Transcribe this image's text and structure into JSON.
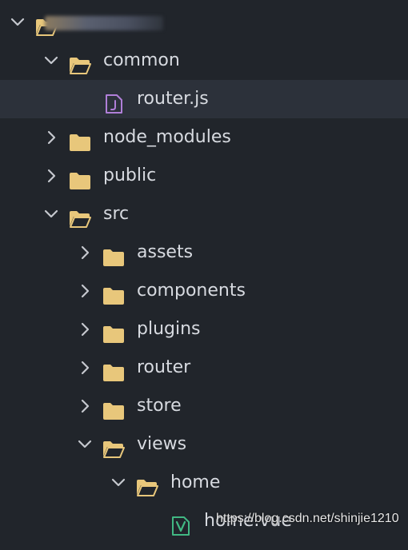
{
  "explorer": {
    "root": {
      "label": "",
      "expanded": true
    },
    "items": [
      {
        "label": "common",
        "type": "folder",
        "expanded": true
      },
      {
        "label": "router.js",
        "type": "file-js",
        "selected": true
      },
      {
        "label": "node_modules",
        "type": "folder",
        "expanded": false
      },
      {
        "label": "public",
        "type": "folder",
        "expanded": false
      },
      {
        "label": "src",
        "type": "folder",
        "expanded": true
      },
      {
        "label": "assets",
        "type": "folder",
        "expanded": false
      },
      {
        "label": "components",
        "type": "folder",
        "expanded": false
      },
      {
        "label": "plugins",
        "type": "folder",
        "expanded": false
      },
      {
        "label": "router",
        "type": "folder",
        "expanded": false
      },
      {
        "label": "store",
        "type": "folder",
        "expanded": false
      },
      {
        "label": "views",
        "type": "folder",
        "expanded": true
      },
      {
        "label": "home",
        "type": "folder",
        "expanded": true
      },
      {
        "label": "home.vue",
        "type": "file-vue"
      }
    ]
  },
  "watermark": "https://blog.csdn.net/shinjie1210",
  "colors": {
    "background": "#21252b",
    "selected_row": "#2c313a",
    "text": "#d7dae0",
    "chevron": "#c5c8ce",
    "folder": "#e8c77b",
    "js_icon": "#b07fd8",
    "vue_icon": "#41b883"
  },
  "icons": {
    "collapsed": "chevron-right-icon",
    "expanded": "chevron-down-icon",
    "folder_closed": "folder-icon",
    "folder_open": "folder-open-icon",
    "js_file": "js-file-icon",
    "vue_file": "vue-file-icon"
  }
}
